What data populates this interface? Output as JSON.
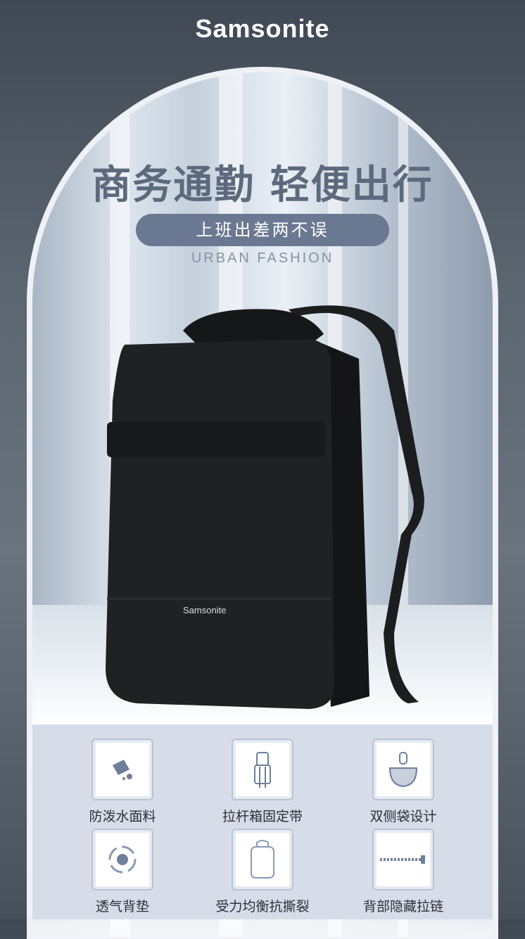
{
  "brand": {
    "logo_text": "Samsonite"
  },
  "hero": {
    "headline": "商务通勤 轻便出行",
    "tagline": "上班出差两不误",
    "subtitle_en": "URBAN FASHION",
    "product_logo": "Samsonite"
  },
  "features": [
    {
      "label": "防泼水面料",
      "icon": "water-splash-icon"
    },
    {
      "label": "拉杆箱固定带",
      "icon": "luggage-trolley-icon"
    },
    {
      "label": "双侧袋设计",
      "icon": "side-pocket-icon"
    },
    {
      "label": "透气背垫",
      "icon": "airflow-icon"
    },
    {
      "label": "受力均衡抗撕裂",
      "icon": "backpack-outline-icon"
    },
    {
      "label": "背部隐藏拉链",
      "icon": "zipper-icon"
    }
  ],
  "colors": {
    "pill": "#6a7891",
    "headline": "#5d6a7e",
    "feature_bg": "#d7dde8"
  }
}
